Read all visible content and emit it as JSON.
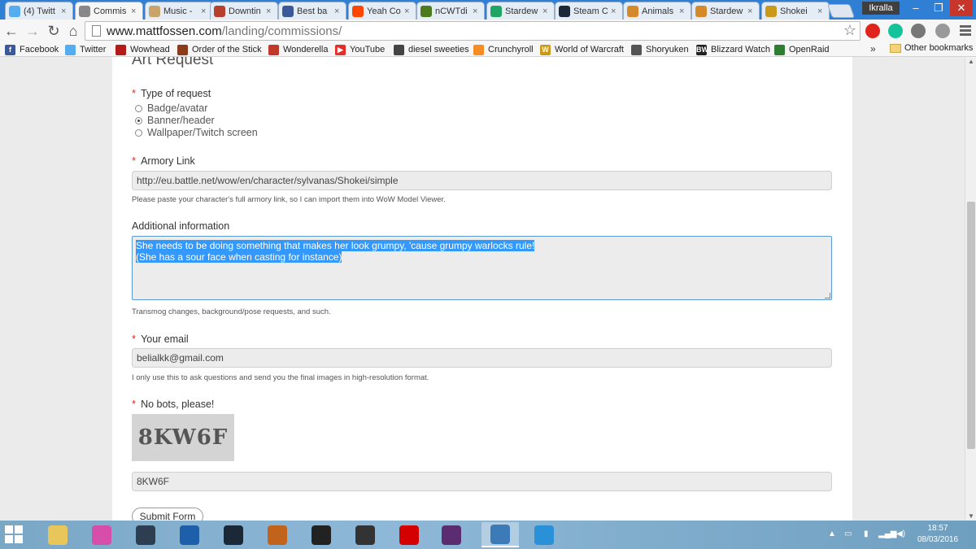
{
  "browser": {
    "tabs": [
      {
        "label": "(4) Twitt",
        "icon": "twitter-icon",
        "color": "#55acee"
      },
      {
        "label": "Commis",
        "icon": "page-icon",
        "color": "#888888",
        "active": true
      },
      {
        "label": "Music -",
        "icon": "music-icon",
        "color": "#c9a46a"
      },
      {
        "label": "Downtin",
        "icon": "downtime-icon",
        "color": "#b5402e"
      },
      {
        "label": "Best ba",
        "icon": "bi-icon",
        "color": "#3b5998"
      },
      {
        "label": "Yeah Co",
        "icon": "reddit-icon",
        "color": "#ff4500"
      },
      {
        "label": "nCWTdi",
        "icon": "ncwt-icon",
        "color": "#4c7a1f"
      },
      {
        "label": "Stardew",
        "icon": "drive-icon",
        "color": "#1fa463"
      },
      {
        "label": "Steam C",
        "icon": "steam-icon",
        "color": "#1b2838"
      },
      {
        "label": "Animals",
        "icon": "animals-icon",
        "color": "#d4892a"
      },
      {
        "label": "Stardew",
        "icon": "stardew-icon",
        "color": "#d4892a"
      },
      {
        "label": "Shokei",
        "icon": "wow-icon",
        "color": "#c99a1a"
      }
    ],
    "close_glyph": "×",
    "profile_name": "Ikralla",
    "window_controls": {
      "minimize": "–",
      "maximize": "❐",
      "close": "✕"
    },
    "nav": {
      "back": "←",
      "forward": "→",
      "reload": "↻",
      "home": "⌂"
    },
    "url_host": "www.mattfossen.com",
    "url_path": "/landing/commissions/",
    "star_glyph": "☆",
    "extensions": [
      {
        "name": "opera-icon",
        "color": "#e0231b"
      },
      {
        "name": "grammarly-icon",
        "color": "#15c39a"
      },
      {
        "name": "cast-icon",
        "color": "#777777"
      },
      {
        "name": "extension-icon",
        "color": "#999999"
      }
    ],
    "bookmarks": [
      {
        "label": "Facebook",
        "icon": "facebook-icon",
        "color": "#3b5998",
        "glyph": "f"
      },
      {
        "label": "Twitter",
        "icon": "twitter-icon",
        "color": "#55acee",
        "glyph": ""
      },
      {
        "label": "Wowhead",
        "icon": "wowhead-icon",
        "color": "#b31a1a",
        "glyph": ""
      },
      {
        "label": "Order of the Stick",
        "icon": "oots-icon",
        "color": "#8b3a1a",
        "glyph": ""
      },
      {
        "label": "Wonderella",
        "icon": "wonderella-icon",
        "color": "#c0392b",
        "glyph": ""
      },
      {
        "label": "YouTube",
        "icon": "youtube-icon",
        "color": "#e52d27",
        "glyph": "▶"
      },
      {
        "label": "diesel sweeties",
        "icon": "dieselsweeties-icon",
        "color": "#444444",
        "glyph": ""
      },
      {
        "label": "Crunchyroll",
        "icon": "crunchyroll-icon",
        "color": "#f78c25",
        "glyph": ""
      },
      {
        "label": "World of Warcraft",
        "icon": "wow-icon",
        "color": "#c99a1a",
        "glyph": "W"
      },
      {
        "label": "Shoryuken",
        "icon": "shoryuken-icon",
        "color": "#555555",
        "glyph": ""
      },
      {
        "label": "Blizzard Watch",
        "icon": "blizzardwatch-icon",
        "color": "#222222",
        "glyph": "BW"
      },
      {
        "label": "OpenRaid",
        "icon": "openraid-icon",
        "color": "#2e7d32",
        "glyph": ""
      }
    ],
    "overflow_glyph": "»",
    "other_bookmarks": "Other bookmarks"
  },
  "form": {
    "heading": "Art Request",
    "required_mark": "*",
    "type_label": "Type of request",
    "type_options": [
      {
        "label": "Badge/avatar",
        "selected": false
      },
      {
        "label": "Banner/header",
        "selected": true
      },
      {
        "label": "Wallpaper/Twitch screen",
        "selected": false
      }
    ],
    "armory_label": "Armory Link",
    "armory_value": "http://eu.battle.net/wow/en/character/sylvanas/Shokei/simple",
    "armory_hint": "Please paste your character's full armory link, so I can import them into WoW Model Viewer.",
    "additional_label": "Additional information",
    "additional_lines": [
      "She needs to be doing something that makes her look grumpy, 'cause grumpy warlocks rule!",
      "(She has a sour face when casting for instance)"
    ],
    "additional_hint": "Transmog changes, background/pose requests, and such.",
    "email_label": "Your email",
    "email_value": "belialkk@gmail.com",
    "email_hint": "I only use this to ask questions and send you the final images in high-resolution format.",
    "captcha_label": "No bots, please!",
    "captcha_image_text": "8KW6F",
    "captcha_value": "8KW6F",
    "submit_label": "Submit Form"
  },
  "taskbar": {
    "apps": [
      {
        "name": "file-explorer-icon",
        "color": "#e8c65a"
      },
      {
        "name": "itunes-icon",
        "color": "#d64ea7"
      },
      {
        "name": "razer-icon",
        "color": "#2c3e50"
      },
      {
        "name": "battlenet-icon",
        "color": "#1d5fa8"
      },
      {
        "name": "steam-icon",
        "color": "#1b2838"
      },
      {
        "name": "hearthstone-icon",
        "color": "#c2631c"
      },
      {
        "name": "cross-app-icon",
        "color": "#222222"
      },
      {
        "name": "teamspeak-icon",
        "color": "#333333"
      },
      {
        "name": "record-icon",
        "color": "#d40000"
      },
      {
        "name": "overwolf-icon",
        "color": "#5b2c6f"
      },
      {
        "name": "chrome-window-icon",
        "color": "#3d7ab8",
        "active": true
      },
      {
        "name": "internet-explorer-icon",
        "color": "#2a90d8"
      }
    ],
    "tray_chevron": "▲",
    "time": "18:57",
    "date": "08/03/2016"
  }
}
